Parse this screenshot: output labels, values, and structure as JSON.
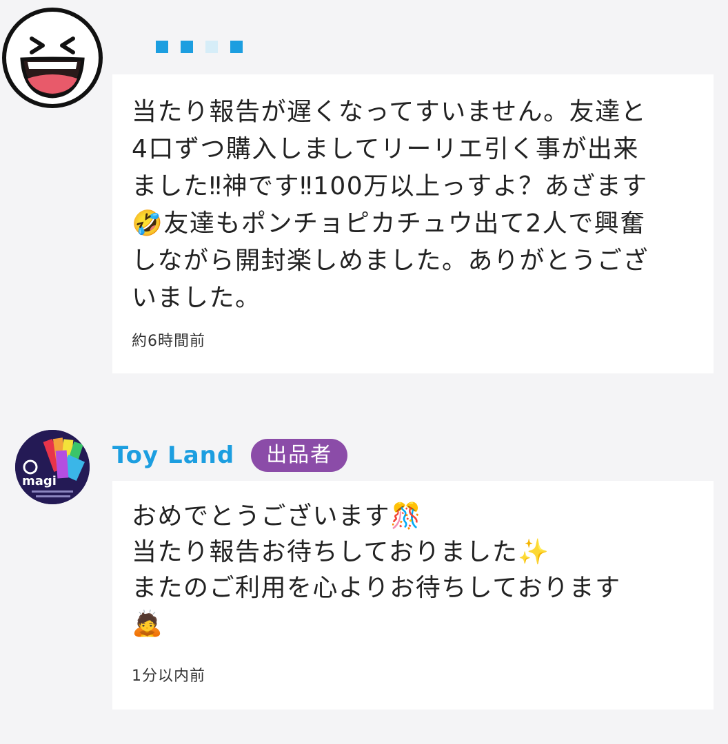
{
  "comments": [
    {
      "avatar_icon": "laughing-face-icon",
      "username_hidden": true,
      "message": "当たり報告が遅くなってすいません。友達と\n4口ずつ購入しましてリーリエ引く事が出来\nました‼︎神です‼︎100万以上っすよ？あざます\n🤣友達もポンチョピカチュウ出て2人で興奮\nしながら開封楽しめました。ありがとうござ\nいました。",
      "time": "約6時間前"
    },
    {
      "avatar_icon": "toy-land-logo",
      "avatar_text": "magi",
      "username": "Toy Land",
      "badge": "出品者",
      "message": "おめでとうございます🎊\n当たり報告お待ちしておりました✨\nまたのご利用を心よりお待ちしております\n🙇",
      "time": "1分以内前"
    }
  ],
  "colors": {
    "link_blue": "#1c9ee0",
    "badge_purple": "#8b4ca8",
    "background": "#f4f4f6"
  }
}
